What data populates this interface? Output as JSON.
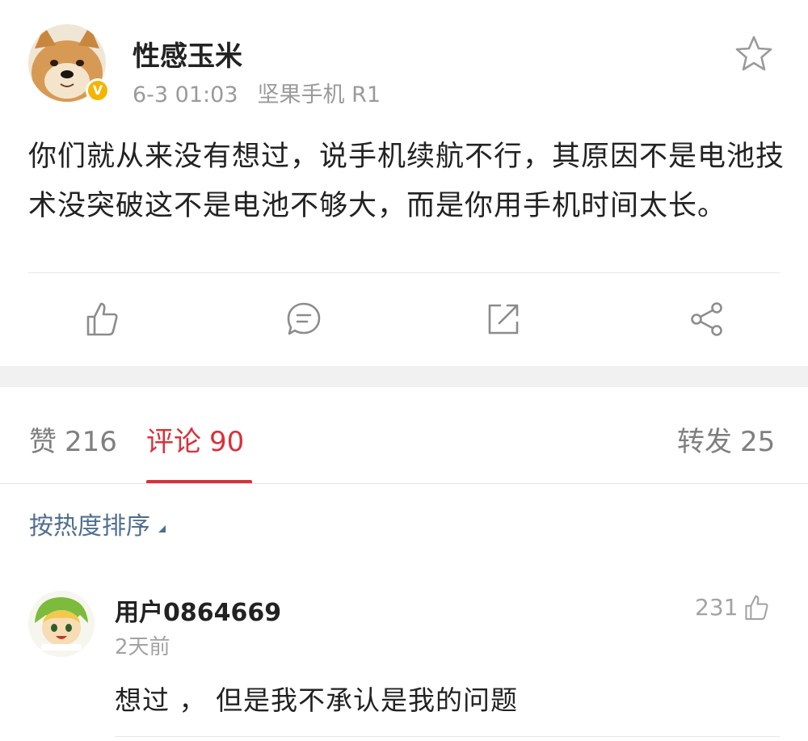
{
  "post": {
    "author": "性感玉米",
    "time": "6-3 01:03",
    "source": "坚果手机 R1",
    "verified_mark": "V",
    "text": "你们就从来没有想过，说手机续航不行，其原因不是电池技术没突破这不是电池不够大，而是你用手机时间太长。",
    "favorite_icon": "star-outline-icon"
  },
  "actions": [
    {
      "icon": "thumbs-up-icon"
    },
    {
      "icon": "comment-bubble-icon"
    },
    {
      "icon": "repost-icon"
    },
    {
      "icon": "share-icon"
    }
  ],
  "tabs": {
    "likes": {
      "label": "赞",
      "count": "216"
    },
    "comments": {
      "label": "评论",
      "count": "90"
    },
    "reposts": {
      "label": "转发",
      "count": "25"
    }
  },
  "sort": {
    "label": "按热度排序"
  },
  "comments": [
    {
      "user": "用户0864669",
      "time": "2天前",
      "likes": "231",
      "text": "想过 ，  但是我不承认是我的问题"
    }
  ],
  "colors": {
    "accent": "#d9313a",
    "link": "#4f6f8f",
    "muted": "#9a9a9a",
    "verified": "#f4b400"
  }
}
